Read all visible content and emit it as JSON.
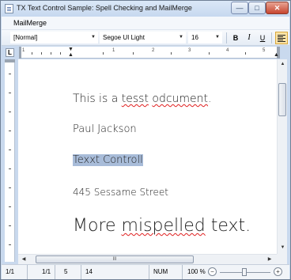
{
  "window": {
    "title": "TX Text Control Sample: Spell Checking and MailMerge",
    "minimize_glyph": "—",
    "maximize_glyph": "□",
    "close_glyph": "✕"
  },
  "menu": {
    "items": [
      "MailMerge"
    ]
  },
  "toolbar": {
    "style_value": "[Normal]",
    "font_value": "Segoe UI Light",
    "size_value": "16",
    "bold_label": "B",
    "italic_label": "I",
    "underline_label": "U",
    "align_left_icon": "align-left-icon",
    "dropdown_arrow": "▼"
  },
  "ruler": {
    "corner_label": "L",
    "numbers": [
      "1",
      "1",
      "2",
      "3",
      "4",
      "5"
    ]
  },
  "document": {
    "line1_a": "This is a ",
    "line1_err1": "tesst",
    "line1_b": " ",
    "line1_err2": "odcument",
    "line1_c": ".",
    "line2": "Paul Jackson",
    "line3": "Texxt Controll",
    "line4": "445 Sessame Street",
    "line5_a": "More ",
    "line5_err": "mispelled",
    "line5_b": " text.",
    "spell_error_color": "#e02020",
    "selection_color": "#a8bcd9"
  },
  "scrollbars": {
    "up": "▲",
    "down": "▼",
    "left": "◀",
    "right": "▶",
    "grip": "III"
  },
  "status": {
    "page": "1/1",
    "section": "1/1",
    "line": "5",
    "column": "14",
    "num": "NUM",
    "zoom": "100 %",
    "zoom_out": "−",
    "zoom_in": "+"
  }
}
